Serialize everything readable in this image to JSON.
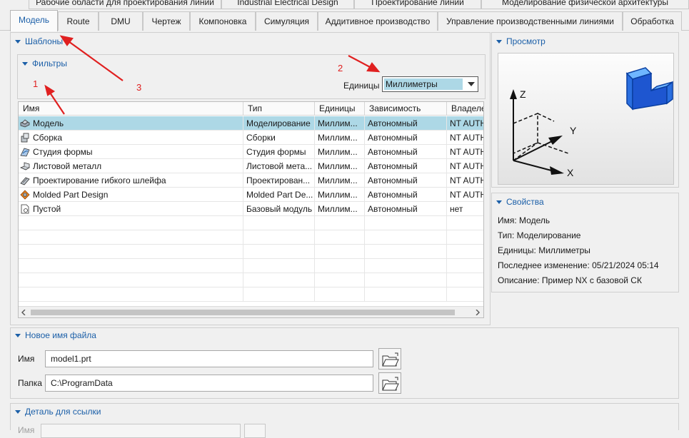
{
  "tabs_top": [
    "Рабочие области для проектирования линии",
    "Industrial Electrical Design",
    "Проектирование линии",
    "Моделирование физической архитектуры"
  ],
  "tabs_main": [
    "Модель",
    "Route",
    "DMU",
    "Чертеж",
    "Компоновка",
    "Симуляция",
    "Аддитивное производство",
    "Управление производственными линиями",
    "Обработка"
  ],
  "templates": {
    "title": "Шаблоны",
    "filters_title": "Фильтры",
    "units_label": "Единицы",
    "units_value": "Миллиметры",
    "columns": [
      "Имя",
      "Тип",
      "Единицы",
      "Зависимость",
      "Владеле"
    ],
    "rows": [
      {
        "icon": "model-icon",
        "name": "Модель",
        "type": "Моделирование",
        "units": "Миллим...",
        "dep": "Автономный",
        "owner": "NT AUTH"
      },
      {
        "icon": "assembly-icon",
        "name": "Сборка",
        "type": "Сборки",
        "units": "Миллим...",
        "dep": "Автономный",
        "owner": "NT AUTH"
      },
      {
        "icon": "shape-studio-icon",
        "name": "Студия формы",
        "type": "Студия формы",
        "units": "Миллим...",
        "dep": "Автономный",
        "owner": "NT AUTH"
      },
      {
        "icon": "sheet-metal-icon",
        "name": "Листовой металл",
        "type": "Листовой мета...",
        "units": "Миллим...",
        "dep": "Автономный",
        "owner": "NT AUTH"
      },
      {
        "icon": "flex-cable-icon",
        "name": "Проектирование гибкого шлейфа",
        "type": "Проектирован...",
        "units": "Миллим...",
        "dep": "Автономный",
        "owner": "NT AUTH"
      },
      {
        "icon": "molded-part-icon",
        "name": "Molded Part Design",
        "type": "Molded Part De...",
        "units": "Миллим...",
        "dep": "Автономный",
        "owner": "NT AUTH"
      },
      {
        "icon": "blank-file-icon",
        "name": "Пустой",
        "type": "Базовый модуль",
        "units": "Миллим...",
        "dep": "Автономный",
        "owner": "нет"
      }
    ]
  },
  "preview": {
    "title": "Просмотр",
    "axis_x": "X",
    "axis_y": "Y",
    "axis_z": "Z"
  },
  "properties": {
    "title": "Свойства",
    "name": "Имя: Модель",
    "type": "Тип: Моделирование",
    "units": "Единицы: Миллиметры",
    "modified": "Последнее изменение: 05/21/2024 05:14",
    "description": "Описание: Пример NX с базовой СК"
  },
  "new_file": {
    "title": "Новое имя файла",
    "name_label": "Имя",
    "name_value": "model1.prt",
    "folder_label": "Папка",
    "folder_value": "C:\\ProgramData"
  },
  "reference": {
    "title": "Деталь для ссылки",
    "name_label": "Имя"
  },
  "annotations": {
    "a1": "1",
    "a2": "2",
    "a3": "3"
  },
  "colors": {
    "accent": "#1b5fa8",
    "selection": "#add8e6",
    "annotation": "#e02020"
  }
}
